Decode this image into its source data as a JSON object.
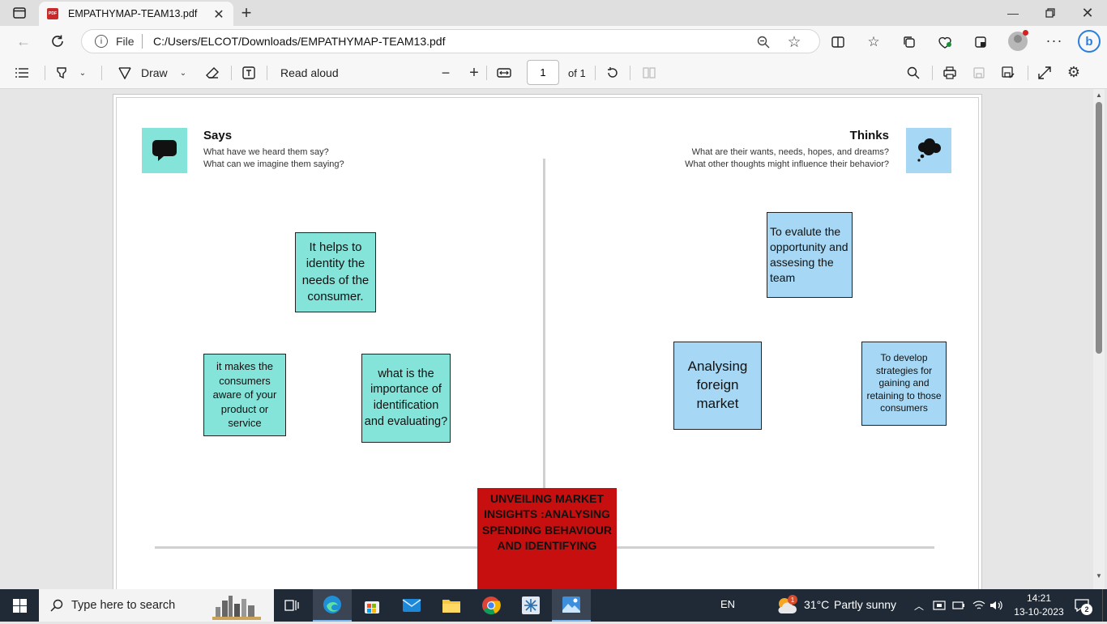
{
  "browser": {
    "tab_title": "EMPATHYMAP-TEAM13.pdf",
    "tab_icon_label": "PDF",
    "url_scheme_label": "File",
    "url": "C:/Users/ELCOT/Downloads/EMPATHYMAP-TEAM13.pdf"
  },
  "pdf_toolbar": {
    "draw_label": "Draw",
    "read_aloud_label": "Read aloud",
    "page_number": "1",
    "page_total": "of 1"
  },
  "empathy_map": {
    "says": {
      "title": "Says",
      "prompt_1": "What have we heard them say?",
      "prompt_2": "What can we imagine them saying?"
    },
    "thinks": {
      "title": "Thinks",
      "prompt_1": "What are their wants, needs, hopes, and dreams?",
      "prompt_2": "What other thoughts might influence their behavior?"
    },
    "says_notes": [
      "It helps to identity the needs of the consumer.",
      "it makes the consumers aware of your product or service",
      "what is the importance of identification and evaluating?"
    ],
    "thinks_notes": [
      "To evalute the opportunity and assesing the team",
      "Analysing foreign market",
      "To develop strategies for gaining and retaining to those consumers"
    ],
    "center_title": "UNVEILING MARKET INSIGHTS :ANALYSING SPENDING BEHAVIOUR AND IDENTIFYING"
  },
  "taskbar": {
    "search_placeholder": "Type here to search",
    "language": "EN",
    "weather_temp": "31°C",
    "weather_text": "Partly sunny",
    "weather_badge": "1",
    "time": "14:21",
    "date": "13-10-2023",
    "notification_count": "2"
  },
  "colors": {
    "teal_note": "#84e4d9",
    "blue_note": "#a6d8f5",
    "center_red": "#c80f0f",
    "taskbar": "#202a36"
  }
}
